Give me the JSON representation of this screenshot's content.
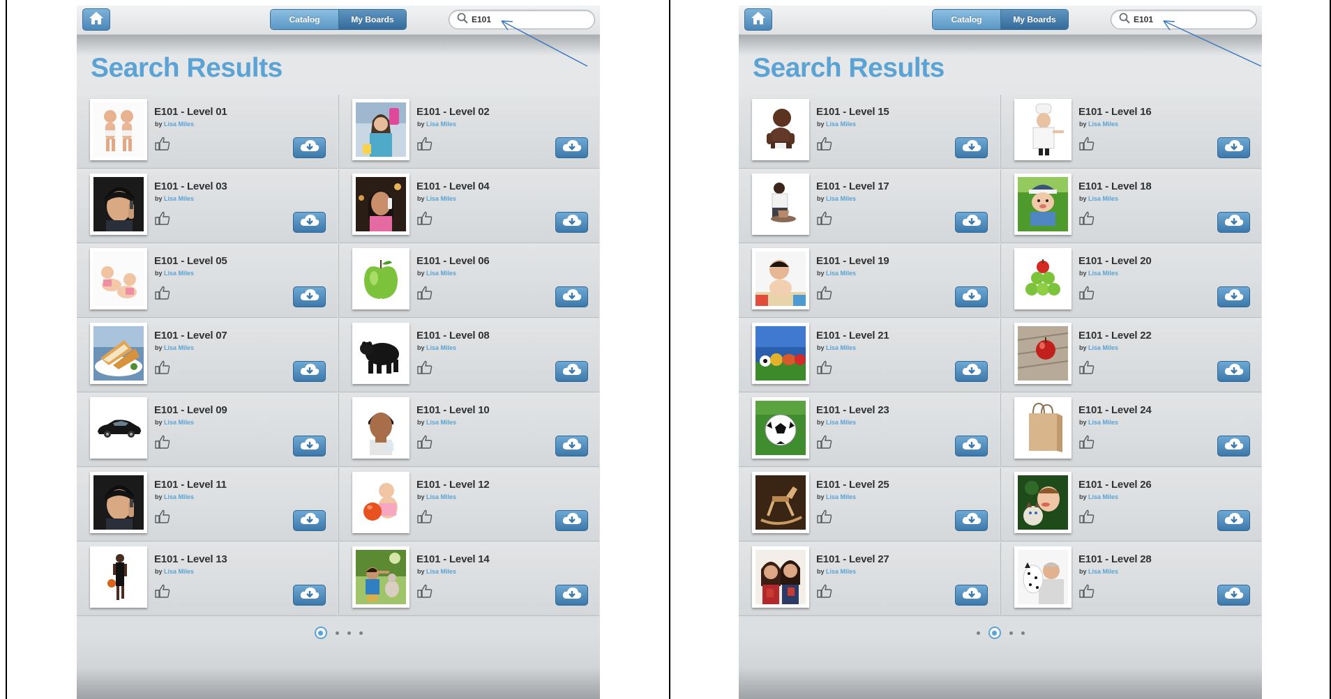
{
  "panels": [
    {
      "topbar": {
        "tabs": [
          "Catalog",
          "My Boards"
        ],
        "search_value": "E101"
      },
      "title": "Search Results",
      "author_prefix": "by",
      "author": "Lisa Miles",
      "items": [
        {
          "name": "E101 - Level 01",
          "image": "twin-babies"
        },
        {
          "name": "E101 - Level 02",
          "image": "woman-cleaning"
        },
        {
          "name": "E101 - Level 03",
          "image": "man-on-phone"
        },
        {
          "name": "E101 - Level 04",
          "image": "girl-on-phone"
        },
        {
          "name": "E101 - Level 05",
          "image": "crawling-babies"
        },
        {
          "name": "E101 - Level 06",
          "image": "green-apple"
        },
        {
          "name": "E101 - Level 07",
          "image": "sandwich-plate"
        },
        {
          "name": "E101 - Level 08",
          "image": "black-bear"
        },
        {
          "name": "E101 - Level 09",
          "image": "black-car"
        },
        {
          "name": "E101 - Level 10",
          "image": "boy-portrait"
        },
        {
          "name": "E101 - Level 11",
          "image": "man-on-phone"
        },
        {
          "name": "E101 - Level 12",
          "image": "baby-with-ball"
        },
        {
          "name": "E101 - Level 13",
          "image": "basketball-player"
        },
        {
          "name": "E101 - Level 14",
          "image": "boy-with-dog"
        }
      ],
      "page_active": 0,
      "page_count": 4
    },
    {
      "topbar": {
        "tabs": [
          "Catalog",
          "My Boards"
        ],
        "search_value": "E101"
      },
      "title": "Search Results",
      "author_prefix": "by",
      "author": "Lisa Miles",
      "items": [
        {
          "name": "E101 - Level 15",
          "image": "sitting-baby"
        },
        {
          "name": "E101 - Level 16",
          "image": "chef"
        },
        {
          "name": "E101 - Level 17",
          "image": "potter"
        },
        {
          "name": "E101 - Level 18",
          "image": "baby-in-grass"
        },
        {
          "name": "E101 - Level 19",
          "image": "baby-on-mat"
        },
        {
          "name": "E101 - Level 20",
          "image": "apple-pile"
        },
        {
          "name": "E101 - Level 21",
          "image": "balls-on-grass"
        },
        {
          "name": "E101 - Level 22",
          "image": "apple-on-wood"
        },
        {
          "name": "E101 - Level 23",
          "image": "soccer-ball"
        },
        {
          "name": "E101 - Level 24",
          "image": "paper-bag"
        },
        {
          "name": "E101 - Level 25",
          "image": "rocking-horse"
        },
        {
          "name": "E101 - Level 26",
          "image": "boy-with-cat"
        },
        {
          "name": "E101 - Level 27",
          "image": "women-laughing"
        },
        {
          "name": "E101 - Level 28",
          "image": "man-with-dalmatian"
        }
      ],
      "page_active": 1,
      "page_count": 4
    }
  ],
  "colors": {
    "accent": "#5aa3d4",
    "button_dark": "#3c78aa",
    "annotation_arrow": "#3a78c0"
  },
  "icons": {
    "home": "home-icon",
    "search": "search-icon",
    "like": "thumbs-up-icon",
    "download": "cloud-download-icon"
  }
}
